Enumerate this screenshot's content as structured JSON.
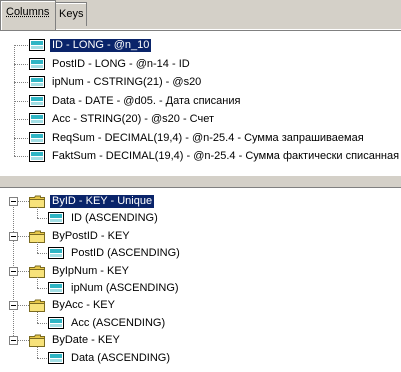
{
  "tabs": [
    {
      "label": "Columns",
      "active": true
    },
    {
      "label": "Keys",
      "active": false
    }
  ],
  "colors": {
    "selection": "#0a246a",
    "field_icon": "#2fb5c4",
    "folder": "#e8c84a"
  },
  "columns": [
    {
      "label": "ID - LONG - @n_10",
      "selected": true
    },
    {
      "label": "PostID - LONG - @n-14 - ID"
    },
    {
      "label": "ipNum - CSTRING(21) - @s20"
    },
    {
      "label": "Data - DATE - @d05. - Дата списания"
    },
    {
      "label": "Acc - STRING(20) - @s20 - Счет"
    },
    {
      "label": "ReqSum - DECIMAL(19,4) - @n-25.4 - Сумма запрашиваемая"
    },
    {
      "label": "FaktSum - DECIMAL(19,4) - @n-25.4 - Сумма фактически списанная"
    }
  ],
  "keys": [
    {
      "label": "ByID - KEY - Unique",
      "selected": true,
      "child": "ID (ASCENDING)"
    },
    {
      "label": "ByPostID - KEY",
      "child": "PostID (ASCENDING)"
    },
    {
      "label": "ByIpNum - KEY",
      "child": "ipNum (ASCENDING)"
    },
    {
      "label": "ByAcc - KEY",
      "child": "Acc (ASCENDING)"
    },
    {
      "label": "ByDate - KEY",
      "child": "Data (ASCENDING)"
    }
  ]
}
